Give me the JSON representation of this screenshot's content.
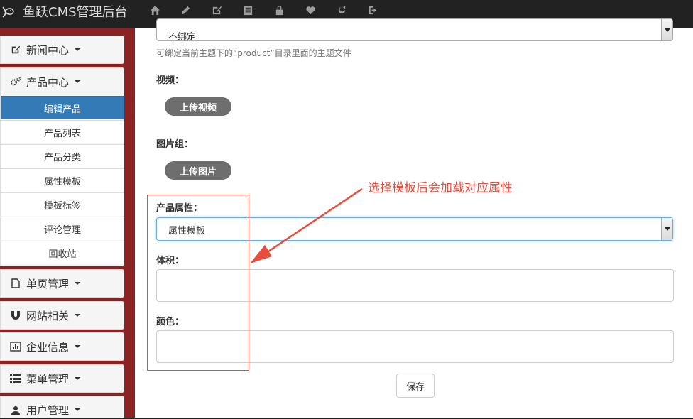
{
  "topbar": {
    "title": "鱼跃CMS管理后台",
    "icons": [
      "home-icon",
      "pencil-icon",
      "edit-icon",
      "list-icon",
      "lock-icon",
      "heart-icon",
      "refresh-icon",
      "logout-icon"
    ]
  },
  "sidebar": {
    "news": "新闻中心",
    "products": "产品中心",
    "sub_items": [
      "编辑产品",
      "产品列表",
      "产品分类",
      "属性模板",
      "模板标签",
      "评论管理",
      "回收站"
    ],
    "pages": "单页管理",
    "site": "网站相关",
    "company": "企业信息",
    "menu": "菜单管理",
    "users": "用户管理"
  },
  "form": {
    "bind_select_value": "不绑定",
    "bind_help": "可绑定当前主题下的“product”目录里面的主题文件",
    "video_label": "视频：",
    "upload_video": "上传视频",
    "image_group_label": "图片组：",
    "upload_image": "上传图片",
    "attr_label": "产品属性：",
    "attr_select_value": "属性模板",
    "volume_label": "体积：",
    "color_label": "颜色：",
    "save": "保存"
  },
  "annotation": {
    "text": "选择模板后会加载对应属性",
    "color": "#e74c3c"
  },
  "colors": {
    "topbar": "#222222",
    "sidebar": "#8b2323",
    "active": "#337ab7"
  }
}
